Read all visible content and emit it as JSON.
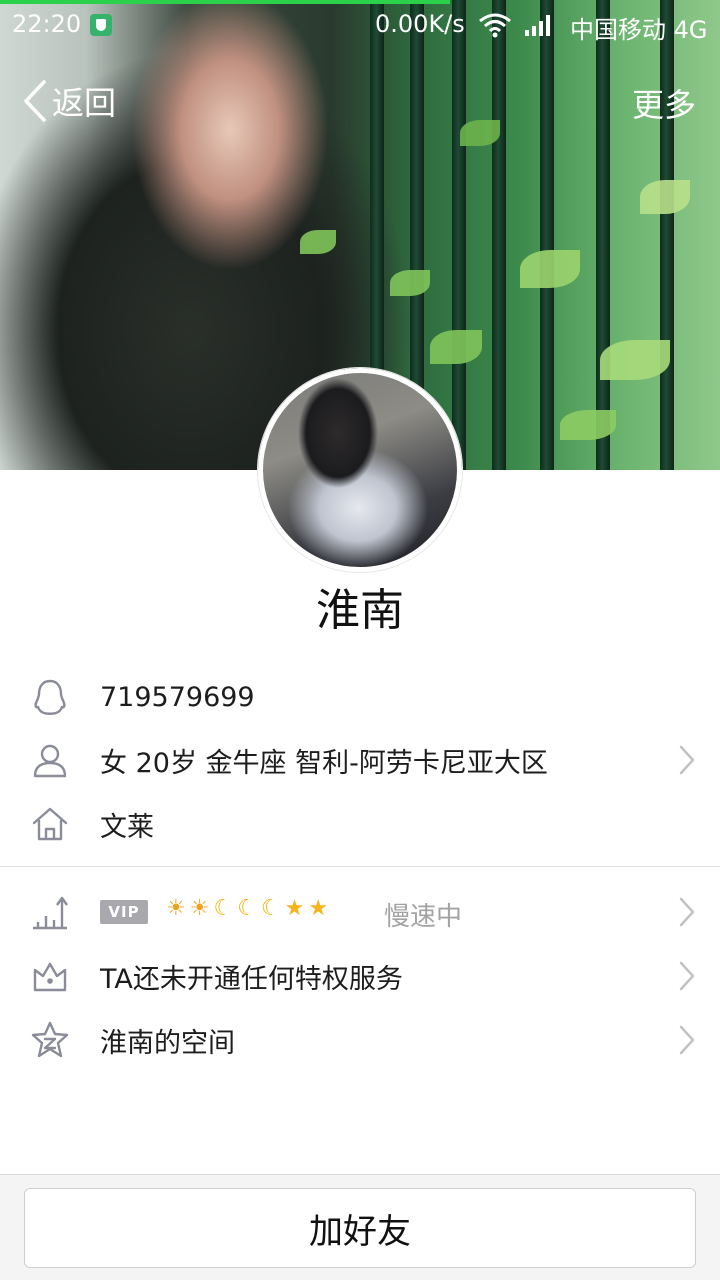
{
  "status_bar": {
    "time": "22:20",
    "net_speed": "0.00K/s",
    "carrier": "中国移动",
    "network": "4G"
  },
  "nav": {
    "back_label": "返回",
    "more_label": "更多"
  },
  "profile": {
    "nickname": "淮南",
    "qq_number": "719579699",
    "basic_info": "女  20岁  金牛座  智利-阿劳卡尼亚大区",
    "hometown": "文莱"
  },
  "vip": {
    "badge": "VIP",
    "level_icons": [
      "sun",
      "sun",
      "moon",
      "moon",
      "moon",
      "star",
      "star"
    ],
    "status": "慢速中"
  },
  "privilege": {
    "label": "TA还未开通任何特权服务"
  },
  "space": {
    "label": "淮南的空间"
  },
  "actions": {
    "add_friend": "加好友"
  }
}
